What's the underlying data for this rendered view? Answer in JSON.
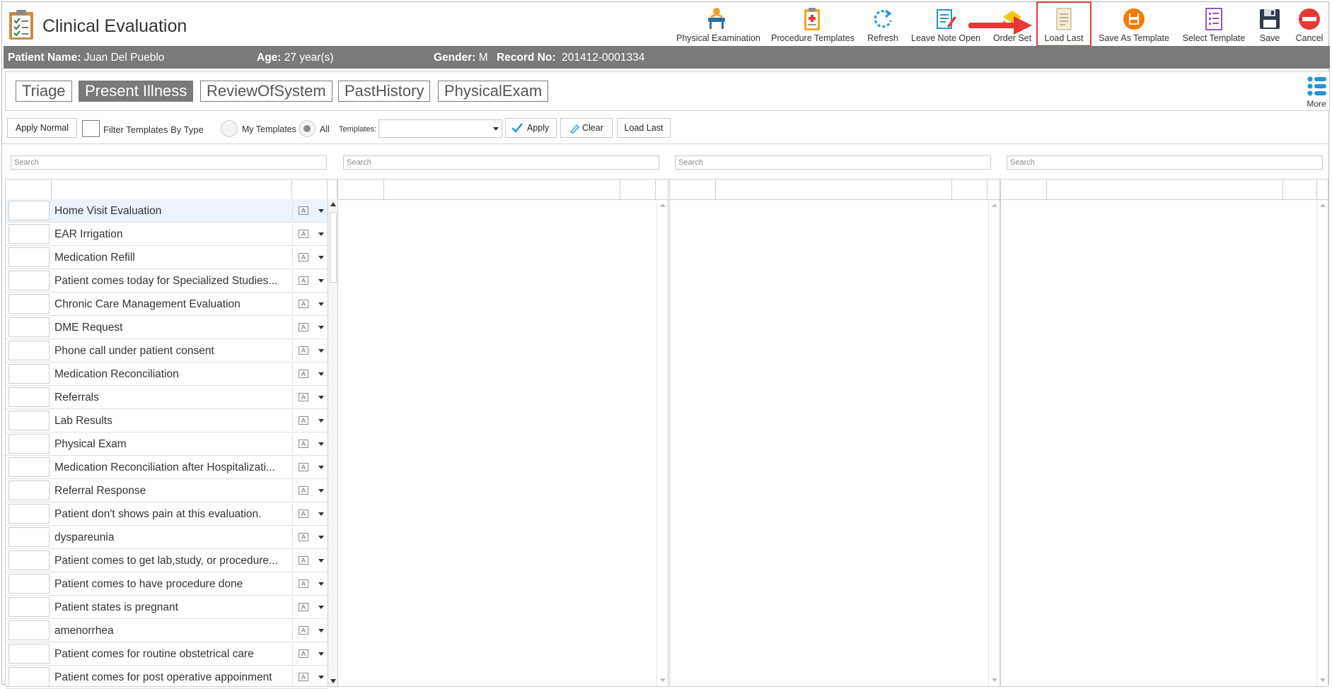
{
  "app": {
    "title": "Clinical Evaluation"
  },
  "toolbar": {
    "physical_examination": "Physical Examination",
    "procedure_templates": "Procedure Templates",
    "refresh": "Refresh",
    "leave_note_open": "Leave Note Open",
    "order_set": "Order Set",
    "load_last": "Load Last",
    "save_as_template": "Save As Template",
    "select_template": "Select Template",
    "save": "Save",
    "cancel": "Cancel"
  },
  "patient": {
    "name_label": "Patient Name:",
    "name": "Juan Del Pueblo",
    "age_label": "Age:",
    "age": "27 year(s)",
    "gender_label": "Gender:",
    "gender": "M",
    "record_label": "Record No:",
    "record": "201412-0001334"
  },
  "tabs": [
    "Triage",
    "Present Illness",
    "ReviewOfSystem",
    "PastHistory",
    "PhysicalExam"
  ],
  "more_label": "More",
  "filter": {
    "apply_normal": "Apply Normal",
    "filter_by_type": "Filter Templates By Type",
    "my_templates": "My Templates",
    "all": "All",
    "templates_label": "Templates:",
    "apply": "Apply",
    "clear": "Clear",
    "load_last": "Load Last"
  },
  "search_placeholder": "Search",
  "templates": [
    "Home Visit Evaluation",
    "EAR Irrigation",
    "Medication Refill",
    "Patient comes today for Specialized Studies...",
    "Chronic Care Management Evaluation",
    "DME Request",
    "Phone call under patient consent",
    "Medication Reconciliation",
    "Referrals",
    "Lab Results",
    "Physical Exam",
    "Medication Reconciliation after Hospitalizati...",
    "Referral Response",
    "Patient don't shows pain at this evaluation.",
    "dyspareunia",
    "Patient comes to get lab,study, or procedure...",
    "Patient comes to have procedure done",
    "Patient states is pregnant",
    "amenorrhea",
    "Patient comes for routine obstetrical care",
    "Patient comes for post operative appoinment"
  ],
  "colors": {
    "header_gray": "#7a7a7a",
    "highlight_red": "#e53935",
    "accent_blue": "#2196d3"
  }
}
